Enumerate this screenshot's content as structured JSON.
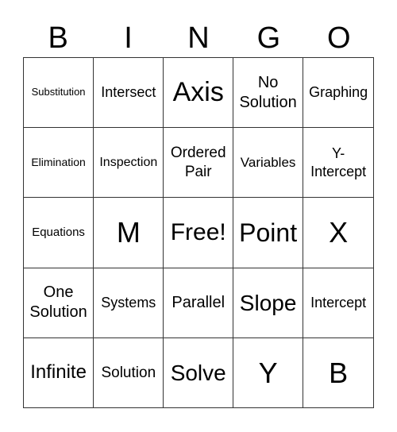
{
  "header": [
    "B",
    "I",
    "N",
    "G",
    "O"
  ],
  "cells": [
    [
      {
        "t": "Substitution",
        "s": 13
      },
      {
        "t": "Intersect",
        "s": 18
      },
      {
        "t": "Axis",
        "s": 34
      },
      {
        "t": "No Solution",
        "s": 20
      },
      {
        "t": "Graphing",
        "s": 18
      }
    ],
    [
      {
        "t": "Elimination",
        "s": 14
      },
      {
        "t": "Inspection",
        "s": 16
      },
      {
        "t": "Ordered Pair",
        "s": 19
      },
      {
        "t": "Variables",
        "s": 17
      },
      {
        "t": "Y-Intercept",
        "s": 18
      }
    ],
    [
      {
        "t": "Equations",
        "s": 15
      },
      {
        "t": "M",
        "s": 36
      },
      {
        "t": "Free!",
        "s": 30
      },
      {
        "t": "Point",
        "s": 32
      },
      {
        "t": "X",
        "s": 36
      }
    ],
    [
      {
        "t": "One Solution",
        "s": 20
      },
      {
        "t": "Systems",
        "s": 18
      },
      {
        "t": "Parallel",
        "s": 20
      },
      {
        "t": "Slope",
        "s": 28
      },
      {
        "t": "Intercept",
        "s": 18
      }
    ],
    [
      {
        "t": "Infinite",
        "s": 24
      },
      {
        "t": "Solution",
        "s": 19
      },
      {
        "t": "Solve",
        "s": 28
      },
      {
        "t": "Y",
        "s": 36
      },
      {
        "t": "B",
        "s": 36
      }
    ]
  ]
}
